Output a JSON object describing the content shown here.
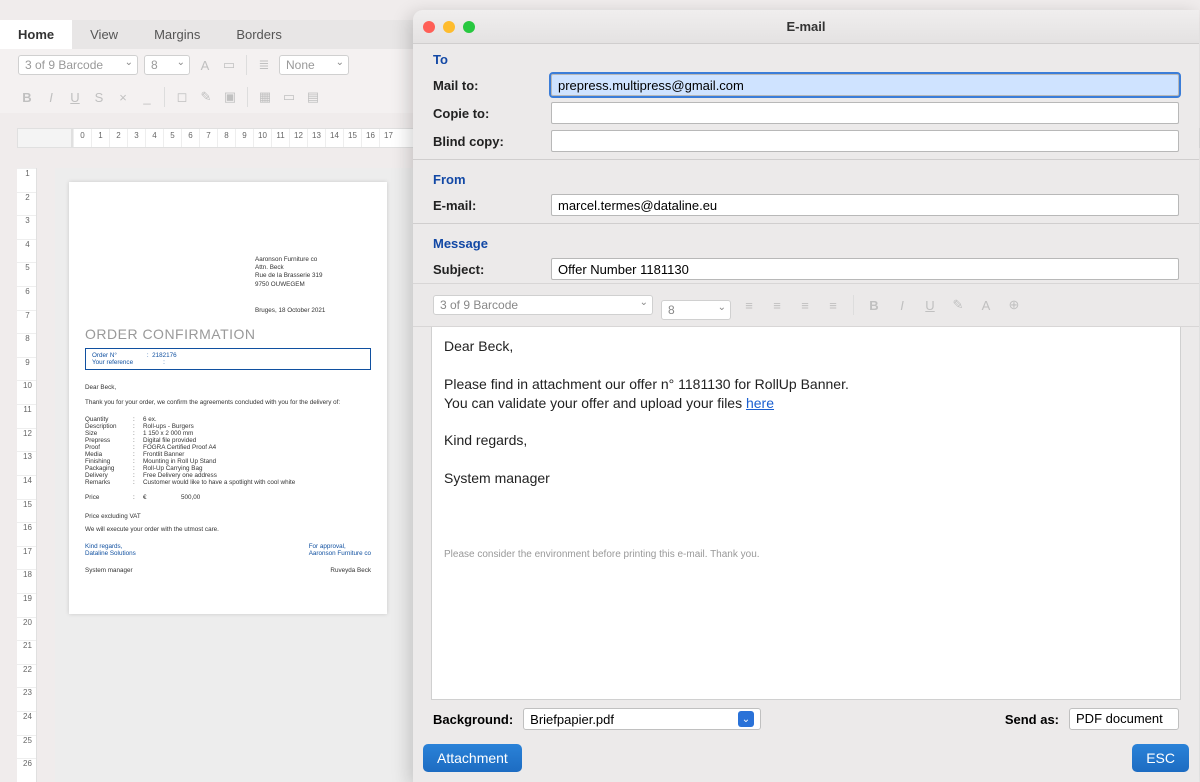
{
  "editor": {
    "tabs": [
      "Home",
      "View",
      "Margins",
      "Borders"
    ],
    "active_tab": 0,
    "font": "3 of 9 Barcode",
    "size": "8",
    "line_spacing": "None",
    "ruler_h": [
      "0",
      "1",
      "2",
      "3",
      "4",
      "5",
      "6",
      "7",
      "8",
      "9",
      "10",
      "11",
      "12",
      "13",
      "14",
      "15",
      "16",
      "17"
    ],
    "ruler_v": [
      "1",
      "2",
      "3",
      "4",
      "5",
      "6",
      "7",
      "8",
      "9",
      "10",
      "11",
      "12",
      "13",
      "14",
      "15",
      "16",
      "17",
      "18",
      "19",
      "20",
      "21",
      "22",
      "23",
      "24",
      "25",
      "26"
    ]
  },
  "document": {
    "addressee": [
      "Aaronson Furniture co",
      "Attn. Beck",
      "Rue de la Brasserie 319",
      "9750  OUWEGEM"
    ],
    "date": "Bruges, 18 October 2021",
    "title": "ORDER CONFIRMATION",
    "order_label": "Order N°",
    "order_value": "2182176",
    "ref_label": "Your reference",
    "ref_value": "",
    "greeting": "Dear Beck,",
    "intro": "Thank you for your order, we confirm the agreements concluded with you for the delivery of:",
    "details": [
      [
        "Quantity",
        "6 ex."
      ],
      [
        "Description",
        "Roll-ups - Burgers"
      ],
      [
        "Size",
        "1 150 x 2 000 mm"
      ],
      [
        "Prepress",
        "Digital file provided"
      ],
      [
        "Proof",
        "FOGRA Certified Proof A4"
      ],
      [
        "Media",
        "Frontlit Banner"
      ],
      [
        "Finishing",
        "Mounting in Roll Up Stand"
      ],
      [
        "Packaging",
        "Roll-Up Carrying Bag"
      ],
      [
        "Delivery",
        "Free Delivery one address"
      ],
      [
        "Remarks",
        "Customer would like to have a spotlight with cool white"
      ]
    ],
    "price_label": "Price",
    "price_currency": "€",
    "price_value": "500,00",
    "ex_vat": "Price excluding VAT",
    "execute": "We will execute your order with the utmost care.",
    "sig_left": [
      "Kind regards,",
      "Dataline Solutions"
    ],
    "sig_right": [
      "For approval,",
      "Aaronson Furniture co"
    ],
    "sm_left": "System manager",
    "sm_right": "Ruveyda Beck"
  },
  "email": {
    "window_title": "E-mail",
    "to_section": "To",
    "mailto_label": "Mail to:",
    "mailto_value": "prepress.multipress@gmail.com",
    "copie_label": "Copie to:",
    "copie_value": "",
    "bcc_label": "Blind copy:",
    "bcc_value": "",
    "from_section": "From",
    "from_label": "E-mail:",
    "from_value": "marcel.termes@dataline.eu",
    "message_section": "Message",
    "subject_label": "Subject:",
    "subject_value": "Offer Number 1181130",
    "toolbar_font": "3 of 9 Barcode",
    "toolbar_size": "8",
    "body_greeting": "Dear Beck,",
    "body_line1": "Please find in attachment our offer n° 1181130 for RollUp Banner.",
    "body_line2a": "You can validate your offer and upload your files ",
    "body_line2_link": "here",
    "body_regards": "Kind regards,",
    "body_signature": "System manager",
    "body_footer": "Please consider the environment before printing this e-mail. Thank you.",
    "bg_label": "Background:",
    "bg_value": "Briefpapier.pdf",
    "sendas_label": "Send as:",
    "sendas_value": "PDF document",
    "attachment_btn": "Attachment",
    "esc_btn": "ESC"
  }
}
